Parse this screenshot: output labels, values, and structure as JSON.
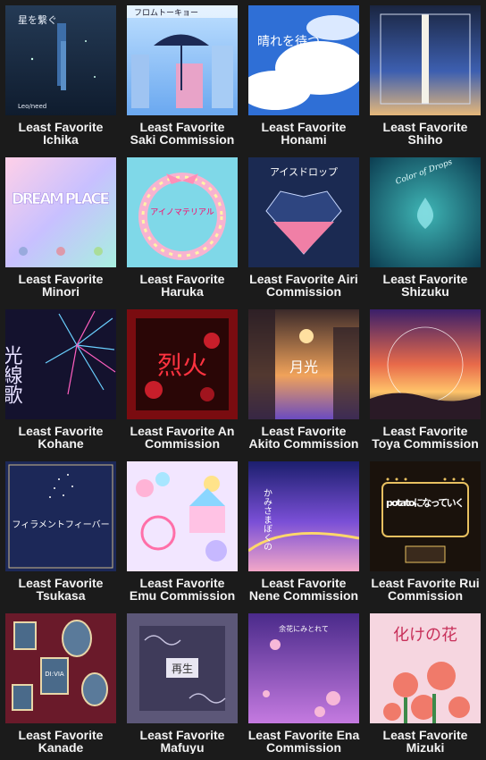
{
  "cards": [
    {
      "line1": "Least Favorite",
      "line2": "Ichika",
      "art_text": "星を繋ぐ",
      "art_sub": "Leo/need",
      "icon": "ichika-cover"
    },
    {
      "line1": "Least Favorite",
      "line2": "Saki Commission",
      "art_text": "フロムトーキョー",
      "art_sub": "",
      "icon": "saki-cover"
    },
    {
      "line1": "Least Favorite",
      "line2": "Honami",
      "art_text": "晴れを待つ",
      "art_sub": "",
      "icon": "honami-cover"
    },
    {
      "line1": "Least Favorite",
      "line2": "Shiho",
      "art_text": "",
      "art_sub": "",
      "icon": "shiho-cover"
    },
    {
      "line1": "Least Favorite",
      "line2": "Minori",
      "art_text": "DREAM PLACE",
      "art_sub": "",
      "icon": "minori-cover"
    },
    {
      "line1": "Least Favorite",
      "line2": "Haruka",
      "art_text": "アイノマテリアル",
      "art_sub": "",
      "icon": "haruka-cover"
    },
    {
      "line1": "Least Favorite Airi",
      "line2": "Commission",
      "art_text": "アイスドロップ",
      "art_sub": "",
      "icon": "airi-cover"
    },
    {
      "line1": "Least Favorite",
      "line2": "Shizuku",
      "art_text": "Color of Drops",
      "art_sub": "",
      "icon": "shizuku-cover"
    },
    {
      "line1": "Least Favorite",
      "line2": "Kohane",
      "art_text": "光線歌",
      "art_sub": "",
      "icon": "kohane-cover"
    },
    {
      "line1": "Least Favorite An",
      "line2": "Commission",
      "art_text": "烈火",
      "art_sub": "",
      "icon": "an-cover"
    },
    {
      "line1": "Least Favorite",
      "line2": "Akito Commission",
      "art_text": "月光",
      "art_sub": "",
      "icon": "akito-cover"
    },
    {
      "line1": "Least Favorite",
      "line2": "Toya Commission",
      "art_text": "",
      "art_sub": "",
      "icon": "toya-cover"
    },
    {
      "line1": "Least Favorite",
      "line2": "Tsukasa",
      "art_text": "フィラメントフィーバー",
      "art_sub": "",
      "icon": "tsukasa-cover"
    },
    {
      "line1": "Least Favorite",
      "line2": "Emu Commission",
      "art_text": "",
      "art_sub": "",
      "icon": "emu-cover"
    },
    {
      "line1": "Least Favorite",
      "line2": "Nene Commission",
      "art_text": "かみさまぼくの",
      "art_sub": "",
      "icon": "nene-cover"
    },
    {
      "line1": "Least Favorite Rui",
      "line2": "Commission",
      "art_text": "potatoになっていく",
      "art_sub": "",
      "icon": "rui-cover"
    },
    {
      "line1": "Least Favorite",
      "line2": "Kanade",
      "art_text": "DI:VIA",
      "art_sub": "",
      "icon": "kanade-cover"
    },
    {
      "line1": "Least Favorite",
      "line2": "Mafuyu",
      "art_text": "再生",
      "art_sub": "",
      "icon": "mafuyu-cover"
    },
    {
      "line1": "Least Favorite Ena",
      "line2": "Commission",
      "art_text": "余花にみとれて",
      "art_sub": "",
      "icon": "ena-cover"
    },
    {
      "line1": "Least Favorite",
      "line2": "Mizuki",
      "art_text": "化けの花",
      "art_sub": "",
      "icon": "mizuki-cover"
    }
  ]
}
